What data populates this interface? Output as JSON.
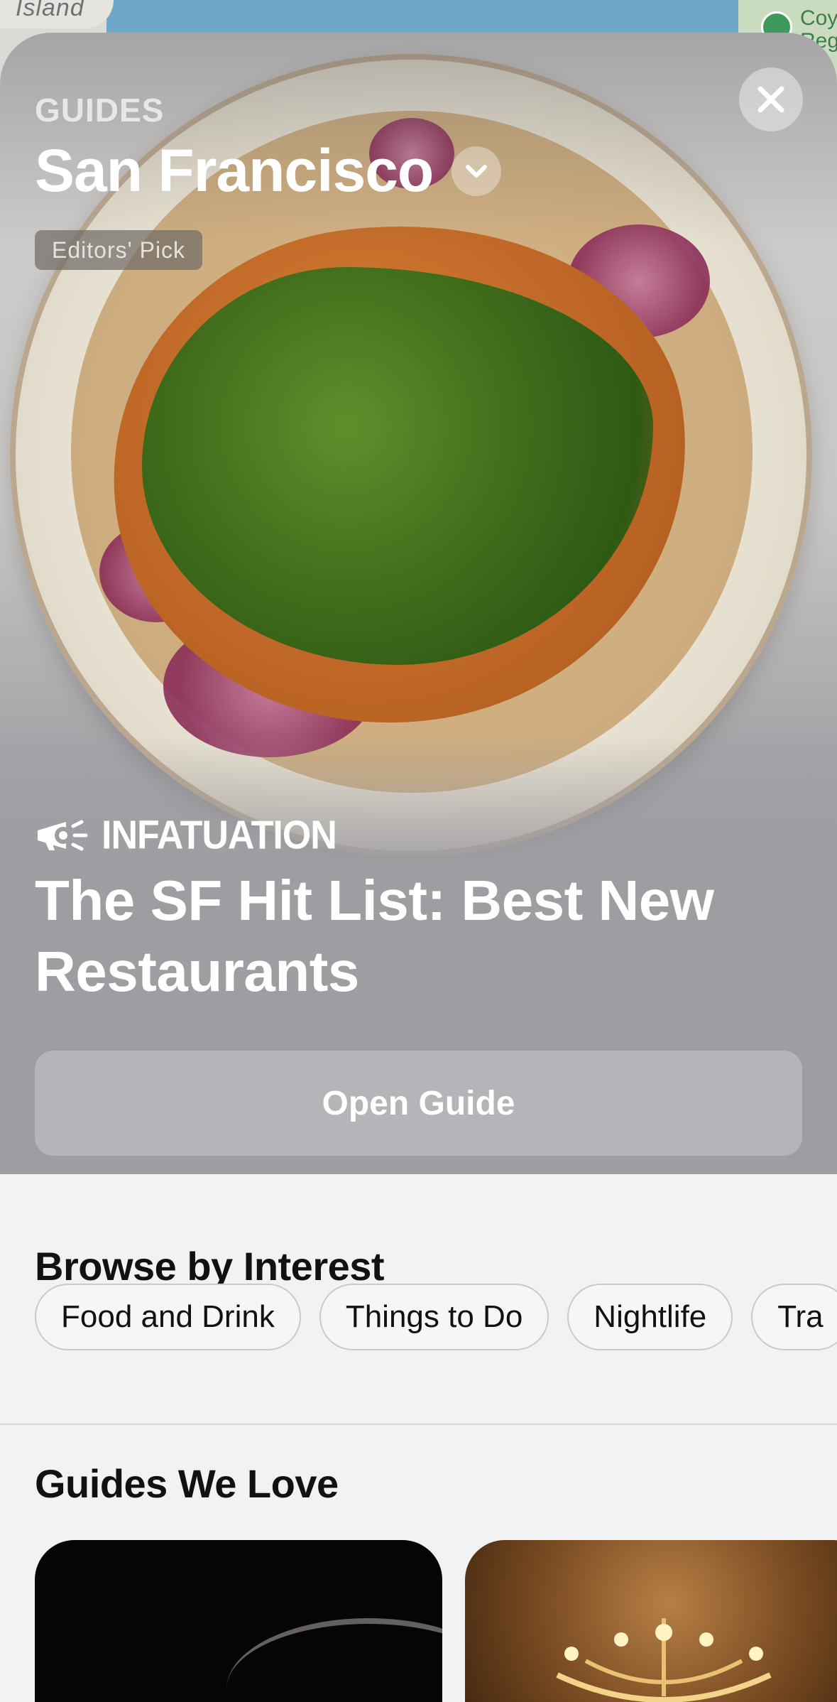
{
  "map": {
    "island_label": "Island",
    "right_label": "Coy\nReg"
  },
  "header": {
    "section_label": "GUIDES",
    "city": "San Francisco",
    "badge": "Editors' Pick"
  },
  "featured": {
    "publisher": "INFATUATION",
    "title": "The SF Hit List: Best New Restaurants",
    "open_button": "Open Guide"
  },
  "browse": {
    "title": "Browse by Interest",
    "chips": [
      "Food and Drink",
      "Things to Do",
      "Nightlife",
      "Tra"
    ]
  },
  "guides": {
    "title": "Guides We Love"
  },
  "icons": {
    "close": "close-icon",
    "chevron": "chevron-down-icon",
    "megaphone": "megaphone-icon",
    "park": "tree-icon"
  }
}
